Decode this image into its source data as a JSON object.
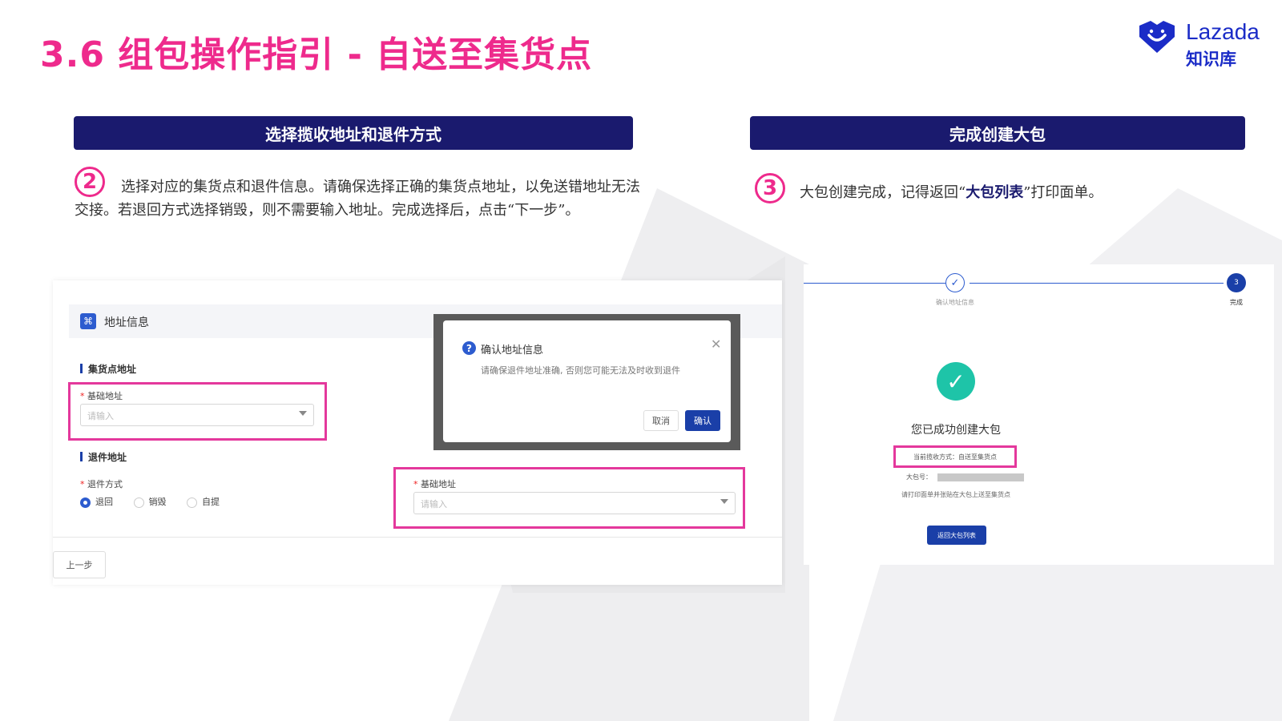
{
  "title": "3.6 组包操作指引 - 自送至集货点",
  "logo": {
    "brand": "Lazada",
    "subtitle": "知识库"
  },
  "left_section": {
    "banner": "选择揽收地址和退件方式",
    "step_number": "2",
    "description": "选择对应的集货点和退件信息。请确保选择正确的集货点地址，以免送错地址无法交接。若退回方式选择销毁，则不需要输入地址。完成选择后，点击“下一步”。"
  },
  "right_section": {
    "banner": "完成创建大包",
    "step_number": "3",
    "description_pre": "大包创建完成，记得返回“",
    "description_bold": "大包列表",
    "description_post": "”打印面单。"
  },
  "address_form": {
    "header_label": "地址信息",
    "collection_title": "集货点地址",
    "basic_address_label": "基础地址",
    "basic_address_placeholder": "请输入",
    "return_title": "退件地址",
    "return_method_label": "退件方式",
    "return_options": [
      "退回",
      "销毁",
      "自提"
    ],
    "return_selected": "退回",
    "return_address_label": "基础地址",
    "return_address_placeholder": "请输入",
    "prev_button": "上一步"
  },
  "confirm_dialog": {
    "title": "确认地址信息",
    "message": "请确保退件地址准确, 否则您可能无法及时收到退件",
    "cancel": "取消",
    "confirm": "确认"
  },
  "completion": {
    "steps": [
      {
        "label": "确认地址信息",
        "state": "done"
      },
      {
        "label": "完成",
        "number": "3",
        "state": "current"
      }
    ],
    "success_text": "您已成功创建大包",
    "pickup_method": "当前揽收方式：自送至集货点",
    "package_no_label": "大包号：",
    "hint": "请打印面单并张贴在大包上送至集货点",
    "back_button": "返回大包列表"
  },
  "colors": {
    "title_pink": "#ee2a8c",
    "banner_navy": "#1a1a6e",
    "highlight_magenta": "#e4389c",
    "primary_blue": "#1a3fa8",
    "success_teal": "#1ec4a8"
  }
}
